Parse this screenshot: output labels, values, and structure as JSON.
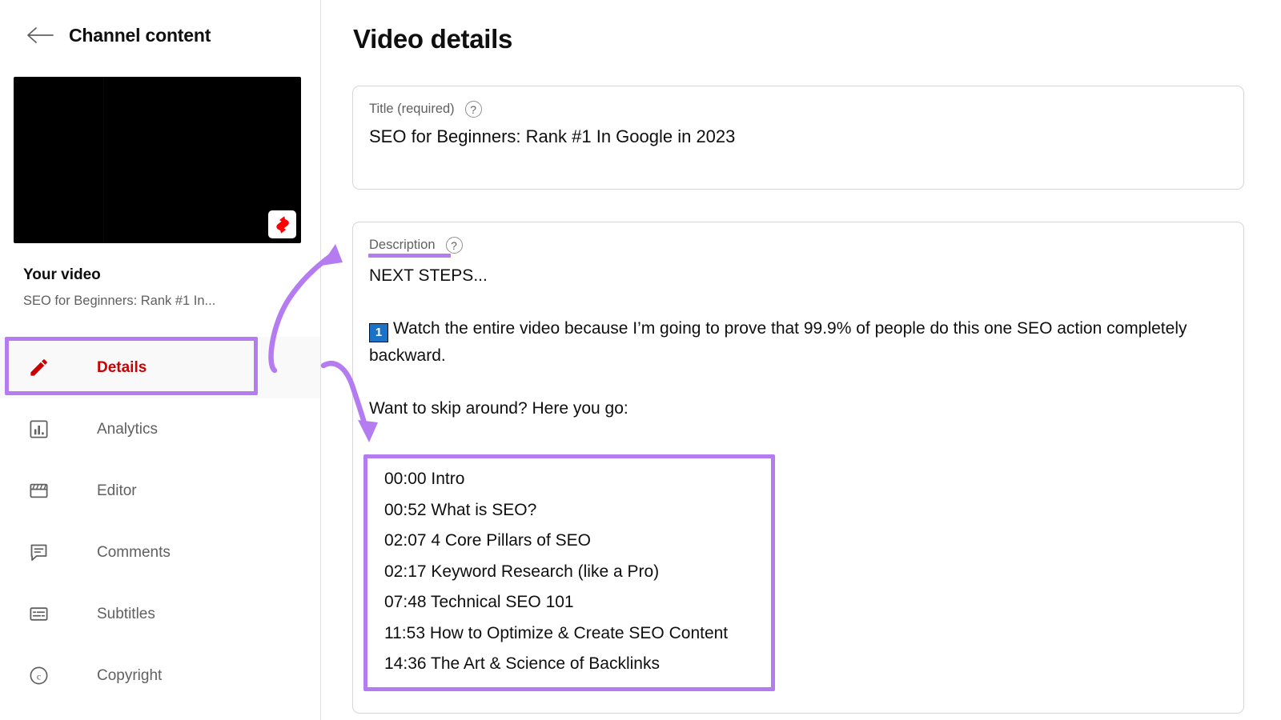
{
  "sidebar": {
    "back_icon": "back-arrow-icon",
    "channel_title": "Channel content",
    "thumbnail": {
      "badge_icon": "youtube-shorts-icon",
      "background_color": "#000000"
    },
    "your_video_label": "Your video",
    "your_video_name": "SEO for Beginners: Rank #1 In...",
    "nav_items": [
      {
        "label": "Details",
        "icon": "pencil-icon",
        "selected": true
      },
      {
        "label": "Analytics",
        "icon": "bar-chart-icon",
        "selected": false
      },
      {
        "label": "Editor",
        "icon": "clapperboard-icon",
        "selected": false
      },
      {
        "label": "Comments",
        "icon": "comment-icon",
        "selected": false
      },
      {
        "label": "Subtitles",
        "icon": "subtitles-icon",
        "selected": false
      },
      {
        "label": "Copyright",
        "icon": "copyright-icon",
        "selected": false
      }
    ]
  },
  "main": {
    "page_title": "Video details",
    "title_field": {
      "label": "Title (required)",
      "help_icon": "help-circle-icon",
      "value": "SEO for Beginners: Rank #1 In Google in 2023"
    },
    "description_field": {
      "label": "Description",
      "help_icon": "help-circle-icon",
      "line_1": "NEXT STEPS...",
      "keycap_1": "1",
      "line_2": "Watch the entire video because I’m going to prove that 99.9% of people do this one SEO action completely backward.",
      "line_3": "Want to skip around? Here you go:",
      "timestamps": [
        "00:00 Intro",
        "00:52 What is SEO?",
        "02:07 4 Core Pillars of SEO",
        "02:17 Keyword Research (like a Pro)",
        "07:48 Technical SEO 101",
        "11:53 How to Optimize & Create SEO Content",
        "14:36 The Art & Science of Backlinks"
      ]
    }
  },
  "annotations": {
    "highlight_color": "#b57bf0",
    "details_box": "highlight-box-details",
    "timestamps_box": "highlight-box-timestamps",
    "description_underline": "underline-description-label",
    "arrow_to_description": "curved-arrow-up",
    "arrow_to_timestamps": "curved-arrow-down"
  },
  "colors": {
    "accent_red": "#cc0000",
    "text_primary": "#0f0f0f",
    "text_secondary": "#606060",
    "border": "#d6d6d6",
    "selected_row": "#f9f9f9"
  }
}
